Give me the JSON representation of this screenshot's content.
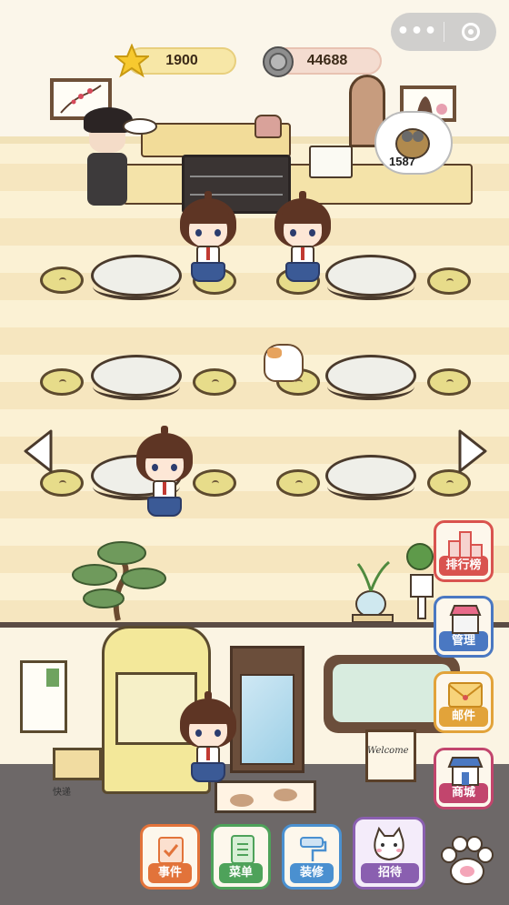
{
  "hud": {
    "stars": "1900",
    "coins": "44688",
    "miniapp_menu": "•••"
  },
  "order_bubble": {
    "count": "1587"
  },
  "side_buttons": [
    {
      "label": "排行榜",
      "icon": "leaderboard-icon",
      "color": "#d9534f"
    },
    {
      "label": "管理",
      "icon": "shop-stall-icon",
      "color": "#4a78c2"
    },
    {
      "label": "邮件",
      "icon": "envelope-icon",
      "color": "#e2a33a"
    },
    {
      "label": "商城",
      "icon": "store-icon",
      "color": "#c2456d"
    }
  ],
  "bottom_buttons": [
    {
      "label": "事件",
      "icon": "checklist-icon",
      "color": "#e2733a"
    },
    {
      "label": "菜单",
      "icon": "menu-book-icon",
      "color": "#4ea25a"
    },
    {
      "label": "装修",
      "icon": "paint-roller-icon",
      "color": "#4a90d0"
    },
    {
      "label": "招待",
      "icon": "cat-face-icon",
      "color": "#8a5fb0"
    }
  ],
  "scene": {
    "welcome_sign": "Welcome",
    "box_label": "快递"
  },
  "colors": {
    "floor_light": "#fbf1d4",
    "floor_dark": "#f6e6bf",
    "hud_pill": "#f7e7a7"
  }
}
